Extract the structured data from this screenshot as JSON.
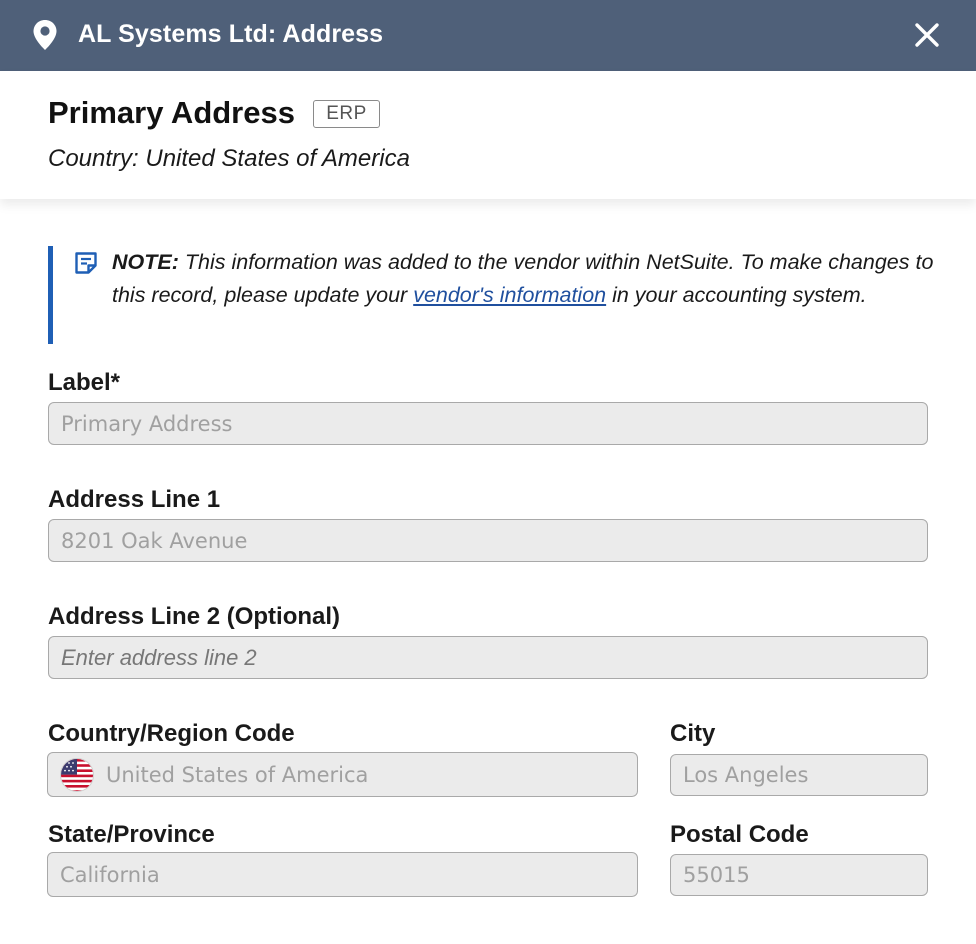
{
  "dialog": {
    "title": "AL Systems Ltd: Address",
    "header_bg": "#4f6079"
  },
  "header": {
    "title": "Primary Address",
    "badge": "ERP",
    "country_line": "Country: United States of America"
  },
  "note": {
    "label": "NOTE:",
    "text_before_link": " This information was added to the vendor within NetSuite. To make changes to this record, please update your ",
    "link_text": "vendor's information",
    "text_after_link": " in your accounting system.",
    "accent_color": "#1f5fb5"
  },
  "fields": {
    "label": {
      "label": "Label*",
      "value": "Primary Address"
    },
    "address1": {
      "label": "Address Line 1",
      "value": "8201 Oak Avenue"
    },
    "address2": {
      "label": "Address Line 2 (Optional)",
      "placeholder": "Enter address line 2"
    },
    "country": {
      "label": "Country/Region Code",
      "value": "United States of America",
      "flag_icon": "us-flag-icon"
    },
    "city": {
      "label": "City",
      "value": "Los Angeles"
    },
    "state": {
      "label": "State/Province",
      "value": "California"
    },
    "postal": {
      "label": "Postal Code",
      "value": "55015"
    }
  }
}
